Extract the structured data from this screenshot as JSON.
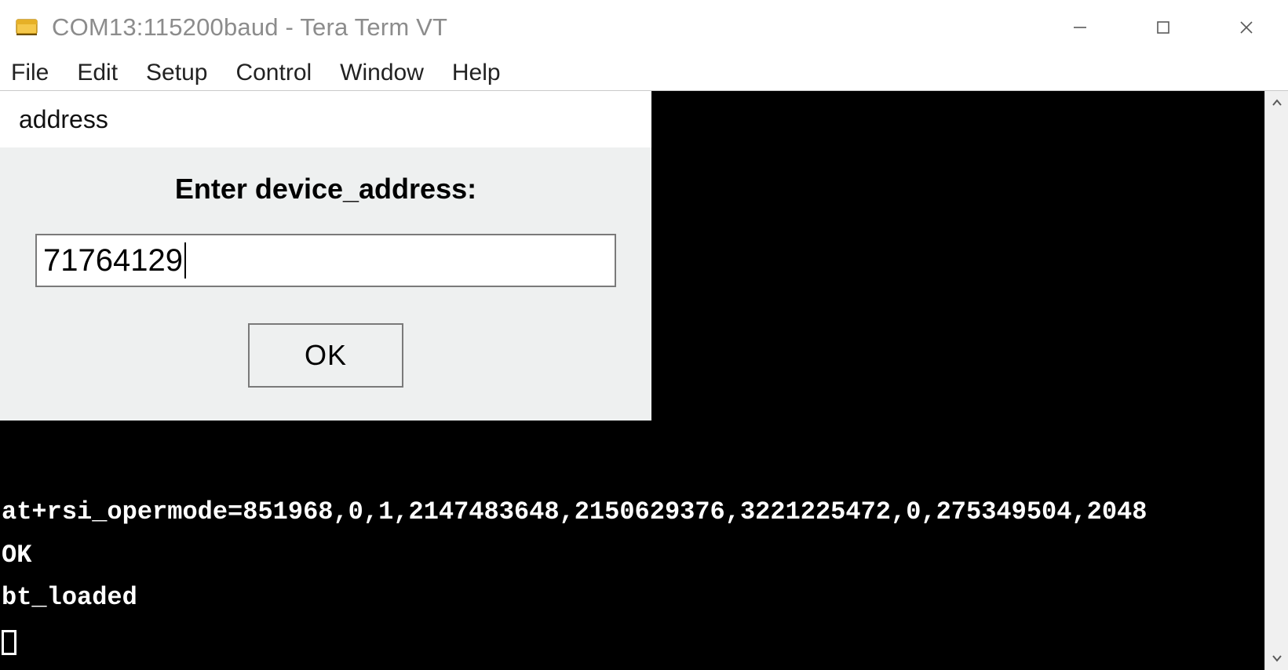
{
  "titlebar": {
    "title": "COM13:115200baud - Tera Term VT"
  },
  "menubar": {
    "items": [
      "File",
      "Edit",
      "Setup",
      "Control",
      "Window",
      "Help"
    ]
  },
  "dialog": {
    "header": "address",
    "prompt": "Enter device_address:",
    "input_value": "71764129",
    "ok_label": "OK"
  },
  "terminal": {
    "line1": "at+rsi_opermode=851968,0,1,2147483648,2150629376,3221225472,0,275349504,2048",
    "line2": "OK",
    "line3": "bt_loaded"
  }
}
